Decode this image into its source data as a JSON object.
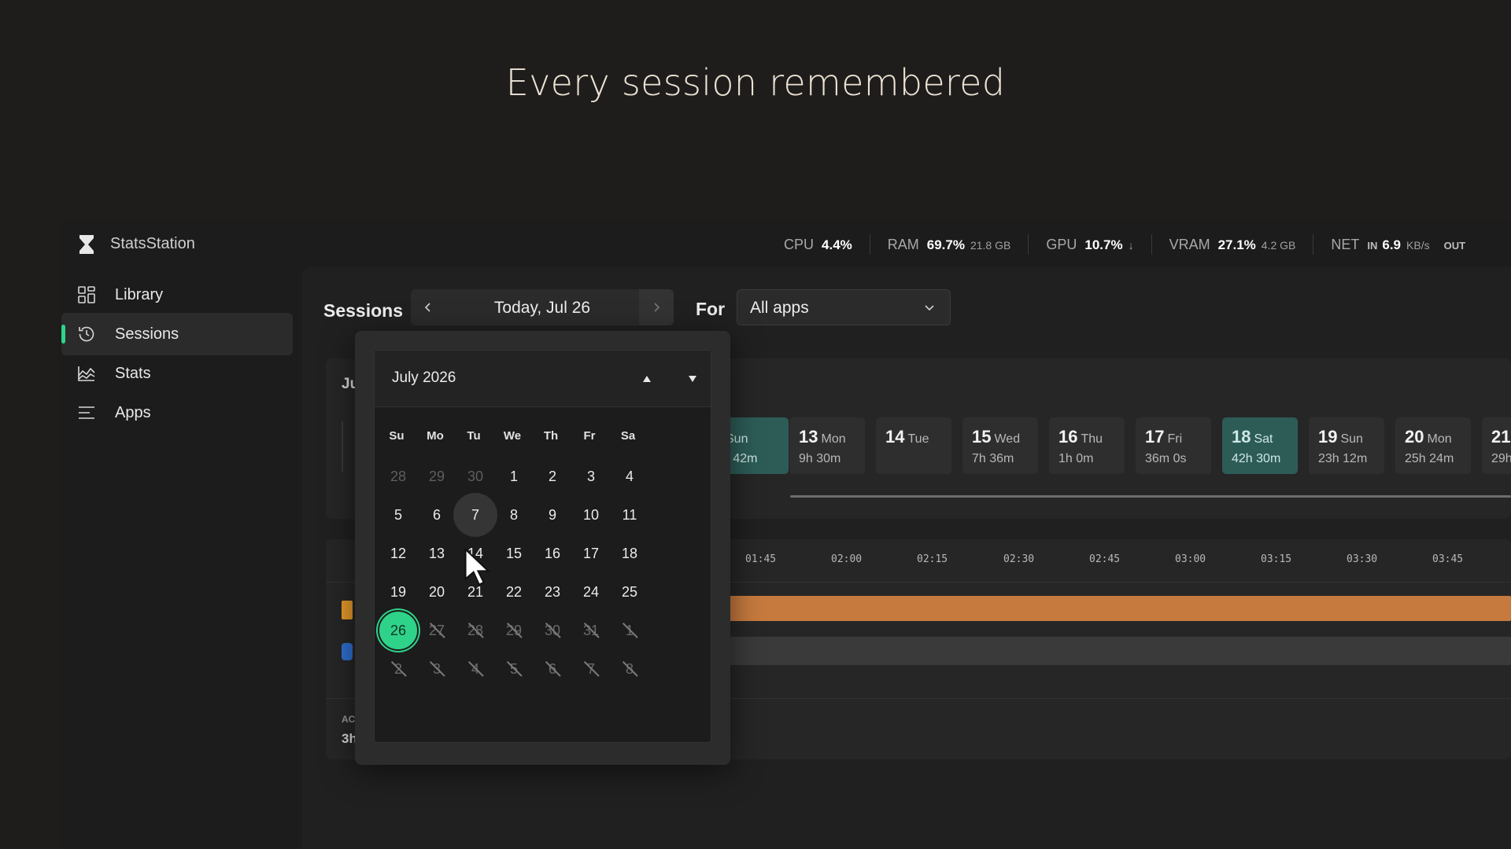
{
  "headline": "Every session remembered",
  "app": {
    "name": "StatsStation"
  },
  "metrics": [
    {
      "label": "CPU",
      "value": "4.4%",
      "sub": ""
    },
    {
      "label": "RAM",
      "value": "69.7%",
      "sub": "21.8 GB"
    },
    {
      "label": "GPU",
      "value": "10.7%",
      "sub": "↓"
    },
    {
      "label": "VRAM",
      "value": "27.1%",
      "sub": "4.2 GB"
    },
    {
      "label": "NET",
      "tag": "IN",
      "value": "6.9",
      "sub": "KB/s",
      "tail": "OUT"
    }
  ],
  "sidebar": {
    "items": [
      {
        "label": "Library",
        "icon": "grid-icon"
      },
      {
        "label": "Sessions",
        "icon": "history-icon",
        "active": true
      },
      {
        "label": "Stats",
        "icon": "chart-icon"
      },
      {
        "label": "Apps",
        "icon": "list-icon"
      }
    ]
  },
  "sessions": {
    "title": "Sessions",
    "date": "Today, Jul 26",
    "for_label": "For",
    "app_filter": "All apps",
    "month_stub": "Ju",
    "ac_stub": "AC",
    "total_stub": "3h"
  },
  "days": [
    {
      "num": "",
      "name": "Sun",
      "dur": "h 42m",
      "hl": true
    },
    {
      "num": "13",
      "name": "Mon",
      "dur": "9h 30m",
      "hl": false
    },
    {
      "num": "14",
      "name": "Tue",
      "dur": "",
      "hl": false
    },
    {
      "num": "15",
      "name": "Wed",
      "dur": "7h 36m",
      "hl": false
    },
    {
      "num": "16",
      "name": "Thu",
      "dur": "1h 0m",
      "hl": false
    },
    {
      "num": "17",
      "name": "Fri",
      "dur": "36m 0s",
      "hl": false
    },
    {
      "num": "18",
      "name": "Sat",
      "dur": "42h 30m",
      "hl": true
    },
    {
      "num": "19",
      "name": "Sun",
      "dur": "23h 12m",
      "hl": false
    },
    {
      "num": "20",
      "name": "Mon",
      "dur": "25h 24m",
      "hl": false
    },
    {
      "num": "21",
      "name": "",
      "dur": "29h",
      "hl": false
    }
  ],
  "timeline": {
    "ticks": [
      "01:45",
      "02:00",
      "02:15",
      "02:30",
      "02:45",
      "03:00",
      "03:15",
      "03:30",
      "03:45"
    ]
  },
  "calendar": {
    "month": "July 2026",
    "weekdays": [
      "Su",
      "Mo",
      "Tu",
      "We",
      "Th",
      "Fr",
      "Sa"
    ],
    "weeks": [
      [
        {
          "d": "28",
          "s": "other"
        },
        {
          "d": "29",
          "s": "other"
        },
        {
          "d": "30",
          "s": "other"
        },
        {
          "d": "1"
        },
        {
          "d": "2"
        },
        {
          "d": "3"
        },
        {
          "d": "4"
        }
      ],
      [
        {
          "d": "5"
        },
        {
          "d": "6"
        },
        {
          "d": "7",
          "s": "hover"
        },
        {
          "d": "8"
        },
        {
          "d": "9"
        },
        {
          "d": "10"
        },
        {
          "d": "11"
        }
      ],
      [
        {
          "d": "12"
        },
        {
          "d": "13"
        },
        {
          "d": "14"
        },
        {
          "d": "15"
        },
        {
          "d": "16"
        },
        {
          "d": "17"
        },
        {
          "d": "18"
        }
      ],
      [
        {
          "d": "19"
        },
        {
          "d": "20"
        },
        {
          "d": "21"
        },
        {
          "d": "22"
        },
        {
          "d": "23"
        },
        {
          "d": "24"
        },
        {
          "d": "25"
        }
      ],
      [
        {
          "d": "26",
          "s": "today"
        },
        {
          "d": "27",
          "s": "disabled"
        },
        {
          "d": "28",
          "s": "disabled"
        },
        {
          "d": "29",
          "s": "disabled"
        },
        {
          "d": "30",
          "s": "disabled"
        },
        {
          "d": "31",
          "s": "disabled"
        },
        {
          "d": "1",
          "s": "disabled"
        }
      ],
      [
        {
          "d": "2",
          "s": "disabled"
        },
        {
          "d": "3",
          "s": "disabled"
        },
        {
          "d": "4",
          "s": "disabled"
        },
        {
          "d": "5",
          "s": "disabled"
        },
        {
          "d": "6",
          "s": "disabled"
        },
        {
          "d": "7",
          "s": "disabled"
        },
        {
          "d": "8",
          "s": "disabled"
        }
      ]
    ]
  },
  "colors": {
    "accent": "#2ed389",
    "highlight_tile": "#2d5c57",
    "session_bar": "#c67a3e"
  }
}
